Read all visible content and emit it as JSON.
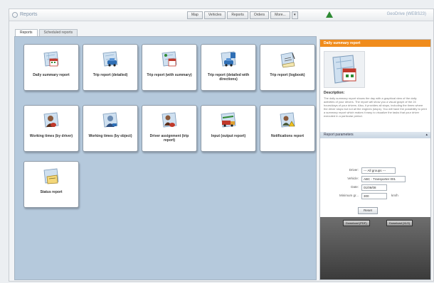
{
  "window": {
    "app_title": "Reports",
    "user_info": "GeoDrive (WEBS23)"
  },
  "nav": {
    "buttons": [
      "Map",
      "Vehicles",
      "Reports",
      "Orders",
      "More..."
    ],
    "dropdown_icon": "chevron-down-icon",
    "alert_icon": "triangle-alert-icon",
    "alert_color": "#2e8a33"
  },
  "tabs": [
    "Reports",
    "Scheduled reports"
  ],
  "reports": [
    {
      "label": "Daily summary report",
      "icon": "map-calendar-icon"
    },
    {
      "label": "Trip report (detailed)",
      "icon": "map-car-icon"
    },
    {
      "label": "Trip report (with summary)",
      "icon": "map-calendar-icon"
    },
    {
      "label": "Trip report (detailed with directions)",
      "icon": "map-car-icon"
    },
    {
      "label": "Trip report (logbook)",
      "icon": "logbook-icon"
    },
    {
      "label": "Working times (by driver)",
      "icon": "map-driver-icon"
    },
    {
      "label": "Working times (by object)",
      "icon": "map-driver-icon"
    },
    {
      "label": "Driver assignment (trip report)",
      "icon": "map-driver-icon"
    },
    {
      "label": "Input (output report)",
      "icon": "map-truck-icon"
    },
    {
      "label": "Notifications report",
      "icon": "map-alert-icon"
    },
    {
      "label": "Status report",
      "icon": "map-folder-icon"
    }
  ],
  "panel": {
    "header": "Daily summary report",
    "description_title": "Description:",
    "description": "The daily summary report shows the day with a graphical view of the daily activities of your drivers. The report will show you a visual graph of the 24 hours/days of your drivers. Also, it provides all stops, including the times where the driver stops but not all the engines (stops). You will have the possibility to print a summary report which makes it easy to visualize the tasks that your driver executed in a particular period.",
    "params_header": "Report parameters",
    "params_toggle": "▴",
    "params": [
      {
        "label": "Driver:",
        "value": "--- All groups ---",
        "kind": "select"
      },
      {
        "label": "Vehicle:",
        "value": "ABC - Transporter 001",
        "kind": "select"
      },
      {
        "label": "Date:",
        "value": "01/06/08",
        "kind": "date"
      },
      {
        "label": "Minimum gr...",
        "value": "300",
        "unit": "km/h",
        "kind": "text"
      }
    ],
    "submit_label": "Reset",
    "footer_buttons": [
      "Download (PDF)",
      "Download (XLS)"
    ],
    "accent_color": "#f08c1c"
  }
}
